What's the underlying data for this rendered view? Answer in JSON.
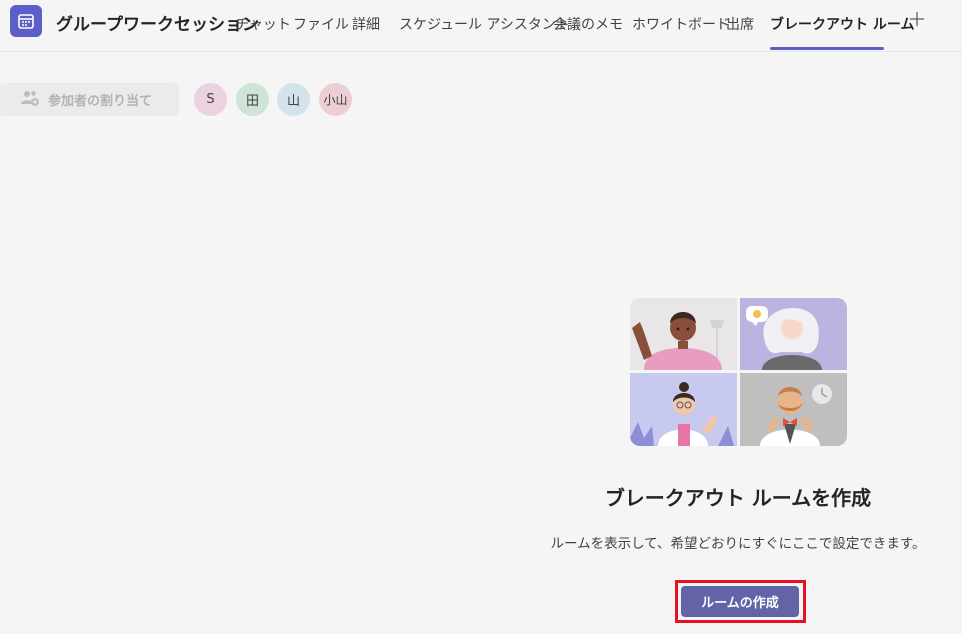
{
  "header": {
    "title": "グループワークセッション",
    "tabs": [
      {
        "label": "チャット"
      },
      {
        "label": "ファイル"
      },
      {
        "label": "詳細"
      },
      {
        "label": "スケジュール アシスタント"
      },
      {
        "label": "会議のメモ"
      },
      {
        "label": "ホワイトボード"
      },
      {
        "label": "出席"
      },
      {
        "label": "ブレークアウト ルーム",
        "active": true
      }
    ],
    "add_tab_icon": "plus-icon"
  },
  "toolbar": {
    "assign_label": "参加者の割り当て",
    "assign_icon": "people-add-icon"
  },
  "participants": [
    {
      "initials": "S",
      "color": "#ecd1e0"
    },
    {
      "initials": "田",
      "color": "#cfe3d7"
    },
    {
      "initials": "山",
      "color": "#d3e3ec"
    },
    {
      "initials": "小山",
      "color": "#eccfd4"
    }
  ],
  "empty_state": {
    "title": "ブレークアウト ルームを作成",
    "description": "ルームを表示して、希望どおりにすぐにここで設定できます。",
    "button_label": "ルームの作成"
  },
  "colors": {
    "accent": "#5b5fc7",
    "button": "#6264a7",
    "highlight": "#e81123"
  }
}
